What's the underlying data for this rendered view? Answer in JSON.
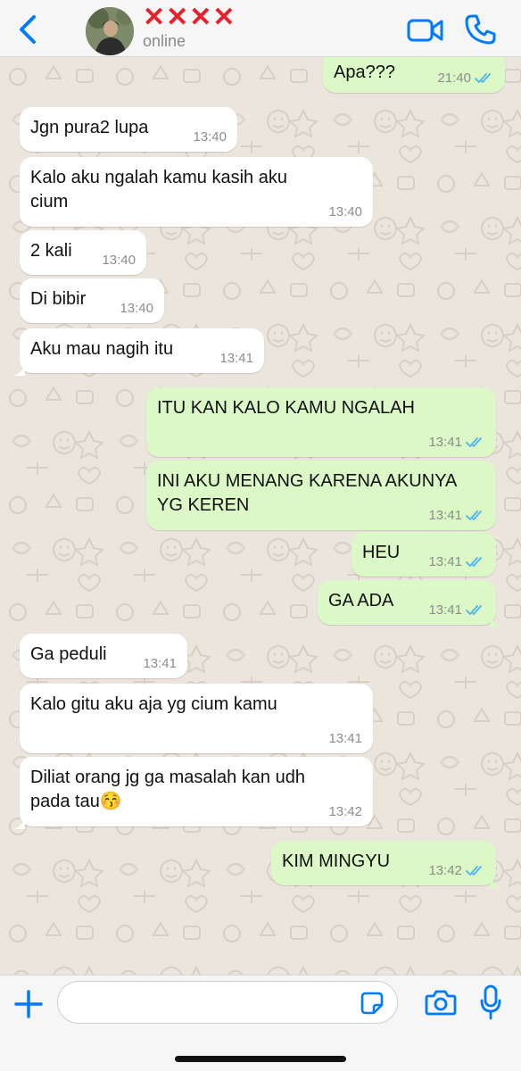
{
  "header": {
    "contact_name": "✕✕✕✕",
    "status": "online"
  },
  "messages": [
    {
      "dir": "out",
      "text": "Apa???",
      "time": "21:40",
      "read": true
    },
    {
      "dir": "in",
      "text": "Jgn pura2 lupa",
      "time": "13:40"
    },
    {
      "dir": "in",
      "text": "Kalo aku ngalah kamu kasih aku\ncium",
      "time": "13:40"
    },
    {
      "dir": "in",
      "text": "2 kali",
      "time": "13:40"
    },
    {
      "dir": "in",
      "text": "Di bibir",
      "time": "13:40"
    },
    {
      "dir": "in",
      "text": "Aku mau nagih itu",
      "time": "13:41"
    },
    {
      "dir": "out",
      "text": "ITU KAN KALO KAMU NGALAH",
      "time": "13:41",
      "read": true
    },
    {
      "dir": "out",
      "text": "INI AKU MENANG KARENA AKUNYA\nYG KEREN",
      "time": "13:41",
      "read": true
    },
    {
      "dir": "out",
      "text": "HEU",
      "time": "13:41",
      "read": true
    },
    {
      "dir": "out",
      "text": "GA ADA",
      "time": "13:41",
      "read": true
    },
    {
      "dir": "in",
      "text": "Ga peduli",
      "time": "13:41"
    },
    {
      "dir": "in",
      "text": "Kalo gitu aku aja yg cium kamu",
      "time": "13:41"
    },
    {
      "dir": "in",
      "text": "Diliat orang jg ga masalah kan udh\npada tau😚",
      "time": "13:42"
    },
    {
      "dir": "out",
      "text": "KIM MINGYU",
      "time": "13:42",
      "read": true
    }
  ],
  "input": {
    "value": "",
    "placeholder": ""
  },
  "colors": {
    "accent": "#007aff",
    "incoming_bubble": "#ffffff",
    "outgoing_bubble": "#dcf8c6",
    "read_ticks": "#4fb6ec",
    "contact_name": "#e8202a"
  },
  "icons": {
    "back": "chevron-left-icon",
    "video": "video-camera-icon",
    "call": "phone-icon",
    "plus": "plus-icon",
    "sticker": "sticker-icon",
    "camera": "camera-icon",
    "mic": "microphone-icon"
  }
}
